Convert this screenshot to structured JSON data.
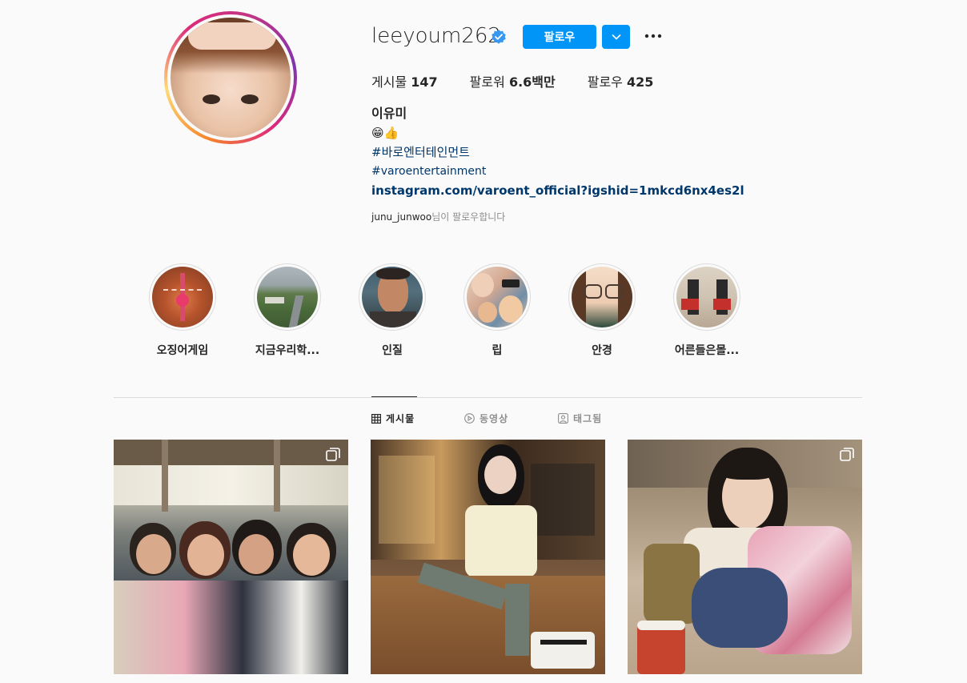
{
  "profile": {
    "username": "leeyoum262",
    "follow_label": "팔로우",
    "stats": {
      "posts_label": "게시물",
      "posts_value": "147",
      "followers_label": "팔로워",
      "followers_value": "6.6백만",
      "following_label": "팔로우",
      "following_value": "425"
    },
    "bio": {
      "name": "이유미",
      "emoji": "😁👍",
      "hashtag_kr": "#바로엔터테인먼트",
      "hashtag_en": "#varoentertainment",
      "link": "instagram.com/varoent_official?igshid=1mkcd6nx4es2l"
    },
    "followed_by_user": "junu_junwoo",
    "followed_by_suffix": "님이 팔로우합니다"
  },
  "highlights": [
    {
      "label": "오징어게임"
    },
    {
      "label": "지금우리학..."
    },
    {
      "label": "인질"
    },
    {
      "label": "립"
    },
    {
      "label": "안경"
    },
    {
      "label": "어른들은몰..."
    }
  ],
  "tabs": [
    {
      "label": "게시물",
      "icon": "grid-icon",
      "active": true
    },
    {
      "label": "동영상",
      "icon": "play-icon",
      "active": false
    },
    {
      "label": "태그됨",
      "icon": "tag-user-icon",
      "active": false
    }
  ],
  "colors": {
    "accent": "#0095f6",
    "link": "#00376b",
    "muted": "#8e8e8e",
    "text": "#262626"
  }
}
